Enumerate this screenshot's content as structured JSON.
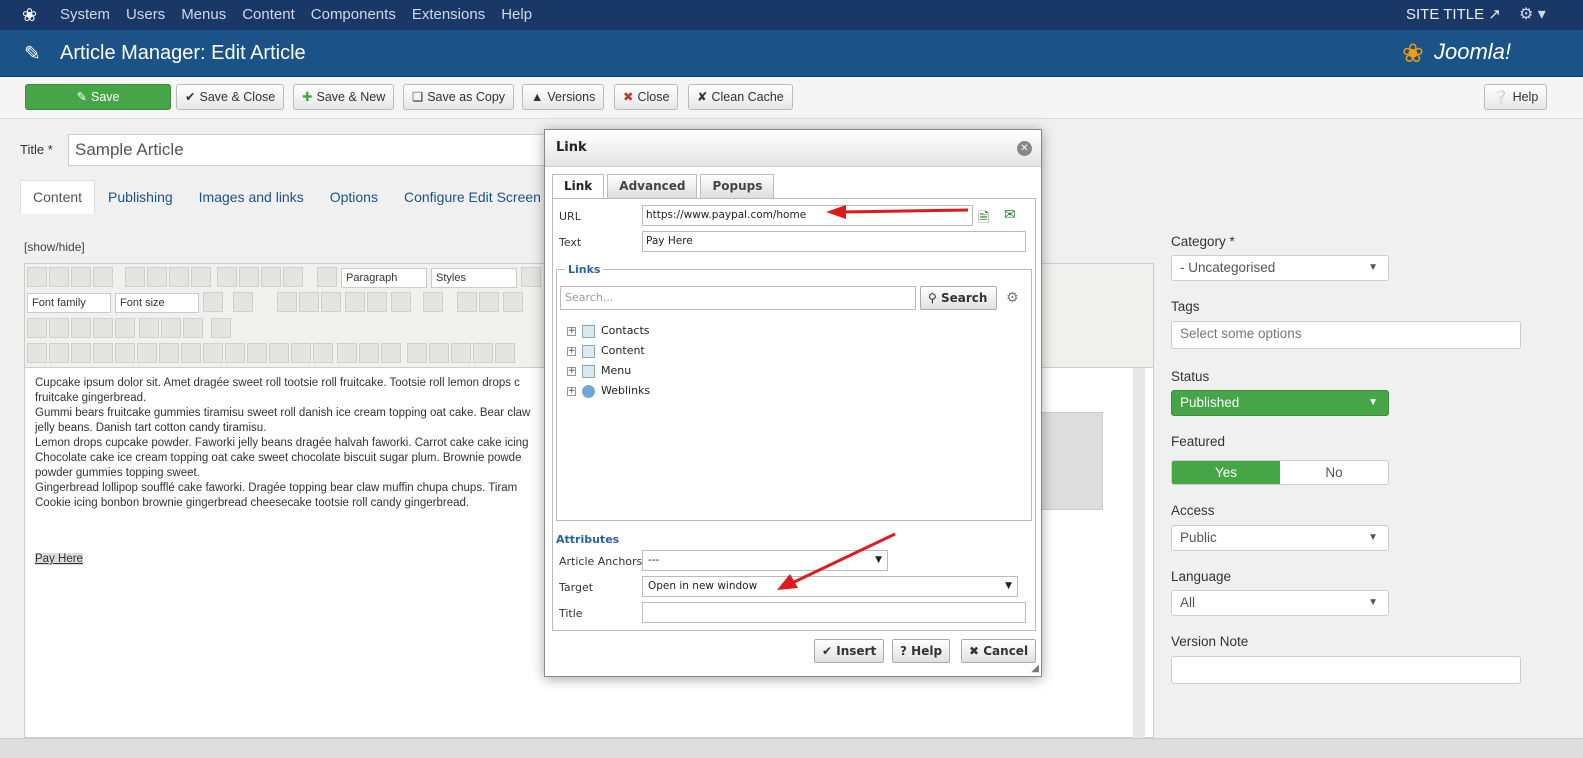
{
  "navbar": {
    "menu": [
      "System",
      "Users",
      "Menus",
      "Content",
      "Components",
      "Extensions",
      "Help"
    ],
    "site_title": "SITE TITLE ↗"
  },
  "header": {
    "title": "Article Manager: Edit Article",
    "brand": "Joomla!"
  },
  "toolbar": {
    "save": "Save",
    "save_close": "Save & Close",
    "save_new": "Save & New",
    "save_copy": "Save as Copy",
    "versions": "Versions",
    "close": "Close",
    "clean_cache": "Clean Cache",
    "help": "Help"
  },
  "article": {
    "title_label": "Title *",
    "title_value": "Sample Article",
    "tabs": [
      "Content",
      "Publishing",
      "Images and links",
      "Options",
      "Configure Edit Screen"
    ],
    "show_hide": "[show/hide]",
    "editor": {
      "paragraph": "Paragraph",
      "styles": "Styles",
      "font_family": "Font family",
      "font_size": "Font size",
      "body": [
        "Cupcake ipsum dolor sit. Amet dragée sweet roll tootsie roll fruitcake. Tootsie roll lemon drops c",
        "fruitcake gingerbread.",
        "Gummi bears fruitcake gummies tiramisu sweet roll danish ice cream topping oat cake. Bear claw",
        "jelly beans. Danish tart cotton candy tiramisu.",
        "Lemon drops cupcake powder. Faworki jelly beans dragée halvah faworki. Carrot cake cake icing",
        "Chocolate cake ice cream topping oat cake sweet chocolate biscuit sugar plum. Brownie powde",
        "powder gummies topping sweet.",
        "Gingerbread lollipop soufflé cake faworki. Dragée topping bear claw muffin chupa chups. Tiram",
        "Cookie icing bonbon brownie gingerbread cheesecake tootsie roll candy gingerbread."
      ],
      "link_text": "Pay Here"
    }
  },
  "sidebar": {
    "category_label": "Category *",
    "category_value": "- Uncategorised",
    "tags_label": "Tags",
    "tags_placeholder": "Select some options",
    "status_label": "Status",
    "status_value": "Published",
    "featured_label": "Featured",
    "featured_yes": "Yes",
    "featured_no": "No",
    "access_label": "Access",
    "access_value": "Public",
    "language_label": "Language",
    "language_value": "All",
    "version_note_label": "Version Note"
  },
  "modal": {
    "title": "Link",
    "tabs": [
      "Link",
      "Advanced",
      "Popups"
    ],
    "url_label": "URL",
    "url_value": "https://www.paypal.com/home",
    "text_label": "Text",
    "text_value": "Pay Here",
    "links_legend": "Links",
    "search_placeholder": "Search...",
    "search_button": "Search",
    "tree": [
      "Contacts",
      "Content",
      "Menu",
      "Weblinks"
    ],
    "attributes_heading": "Attributes",
    "anchors_label": "Article Anchors",
    "anchors_value": "---",
    "target_label": "Target",
    "target_value": "Open in new window",
    "title_label": "Title",
    "insert": "Insert",
    "help": "Help",
    "cancel": "Cancel"
  },
  "colors": {
    "navbar": "#1a3867",
    "header": "#1b5288",
    "success": "#46a546",
    "annotation_arrow": "#e01a1a"
  }
}
